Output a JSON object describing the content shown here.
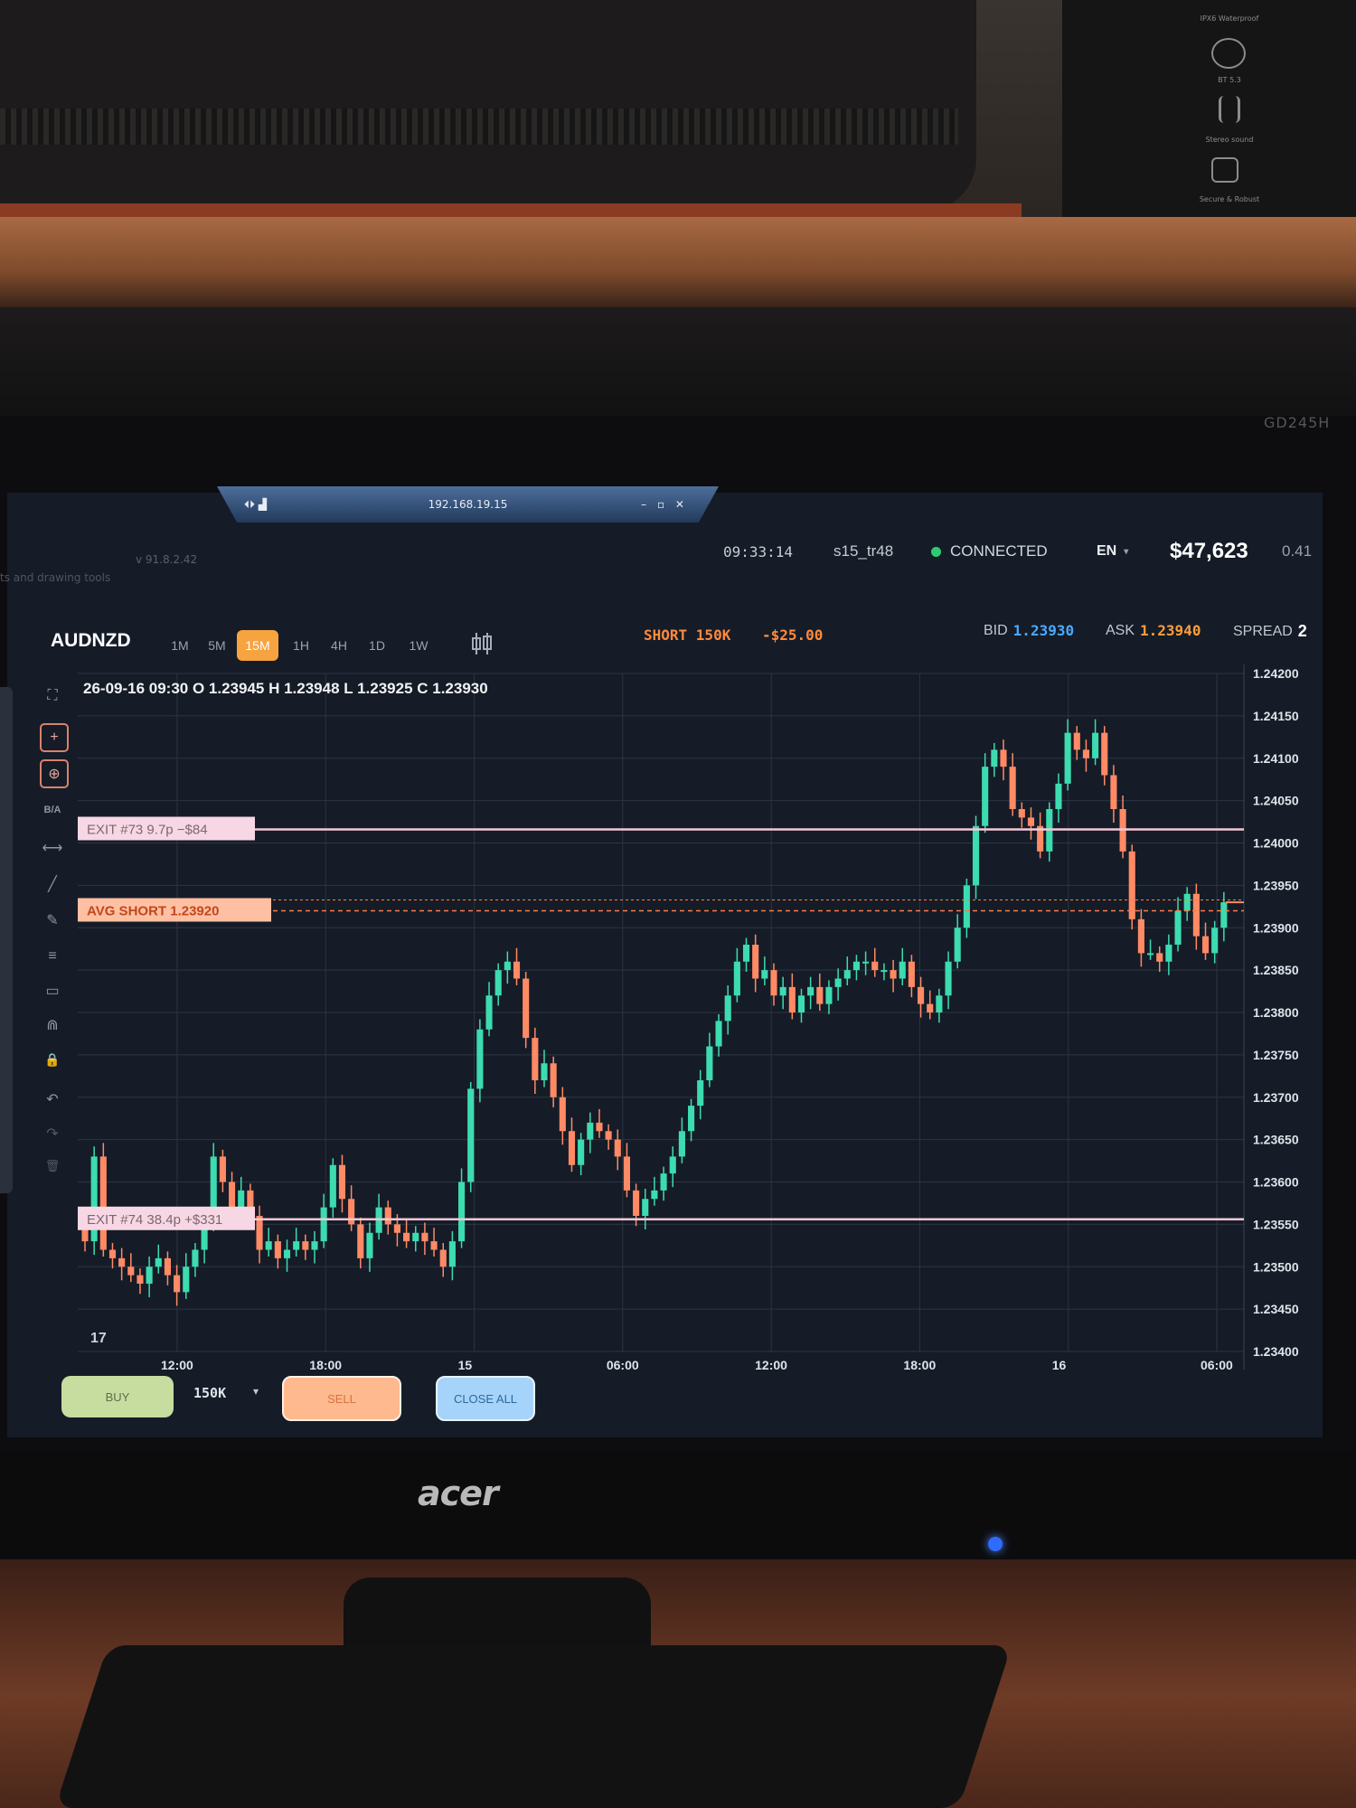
{
  "window": {
    "remote_host": "192.168.19.15",
    "remote_left_icons": "⏴⏵ ▟",
    "remote_controls": "– ▫ ✕",
    "version": "v 91.8.2.42",
    "tools_hint": "ts and drawing tools"
  },
  "status": {
    "clock": "09:33:14",
    "user": "s15_tr48",
    "connection": "CONNECTED",
    "language": "EN",
    "language_caret": "▾",
    "balance": "$47,623",
    "balance_extra": "0.41"
  },
  "toolbar": {
    "symbol": "AUDNZD",
    "timeframes": [
      "1M",
      "5M",
      "15M",
      "1H",
      "4H",
      "1D",
      "1W"
    ],
    "active_timeframe": "15M",
    "candle_icon": "candlestick-icon",
    "position": "SHORT 150K",
    "pnl": "-$25.00",
    "bid_label": "BID",
    "bid": "1.23930",
    "ask_label": "ASK",
    "ask": "1.23940",
    "spread_label": "SPREAD",
    "spread": "2"
  },
  "tools": {
    "fullscreen_icon": "⛶",
    "crosshair_icon": "+",
    "add_icon": "⊕",
    "ba_label": "B/A",
    "hline_icon": "⟷",
    "line_icon": "╱",
    "brush_icon": "✎",
    "fib_icon": "≡",
    "rect_icon": "▭",
    "magnet_icon": "⋒",
    "lock_icon": "🔒",
    "undo_icon": "↶",
    "redo_icon": "↷",
    "trash_icon": "🗑"
  },
  "ohlc": "26-09-16 09:30 O 1.23945 H 1.23948 L 1.23925 C 1.23930",
  "chart_data": {
    "type": "candlestick",
    "symbol": "AUDNZD",
    "timeframe": "15M",
    "y_ticks": [
      "1.24200",
      "1.24150",
      "1.24100",
      "1.24050",
      "1.24000",
      "1.23950",
      "1.23900",
      "1.23850",
      "1.23800",
      "1.23750",
      "1.23700",
      "1.23650",
      "1.23600",
      "1.23550",
      "1.23500",
      "1.23450",
      "1.23400"
    ],
    "ylim": [
      1.234,
      1.242
    ],
    "x_ticks": [
      "12:00",
      "18:00",
      "15",
      "06:00",
      "12:00",
      "18:00",
      "16",
      "06:00"
    ],
    "grid": true,
    "closes": [
      1.2353,
      1.2363,
      1.2352,
      1.2351,
      1.235,
      1.2349,
      1.2348,
      1.235,
      1.2351,
      1.2349,
      1.2347,
      1.235,
      1.2352,
      1.2355,
      1.2363,
      1.236,
      1.2357,
      1.2359,
      1.2356,
      1.2352,
      1.2353,
      1.2351,
      1.2352,
      1.2353,
      1.2352,
      1.2353,
      1.2357,
      1.2362,
      1.2358,
      1.2355,
      1.2351,
      1.2354,
      1.2357,
      1.2355,
      1.2354,
      1.2353,
      1.2354,
      1.2353,
      1.2352,
      1.235,
      1.2353,
      1.236,
      1.2371,
      1.2378,
      1.2382,
      1.2385,
      1.2386,
      1.2384,
      1.2377,
      1.2372,
      1.2374,
      1.237,
      1.2366,
      1.2362,
      1.2365,
      1.2367,
      1.2366,
      1.2365,
      1.2363,
      1.2359,
      1.2356,
      1.2358,
      1.2359,
      1.2361,
      1.2363,
      1.2366,
      1.2369,
      1.2372,
      1.2376,
      1.2379,
      1.2382,
      1.2386,
      1.2388,
      1.2384,
      1.2385,
      1.2382,
      1.2383,
      1.238,
      1.2382,
      1.2383,
      1.2381,
      1.2383,
      1.2384,
      1.2385,
      1.2386,
      1.2386,
      1.2385,
      1.2385,
      1.2384,
      1.2386,
      1.2383,
      1.2381,
      1.238,
      1.2382,
      1.2386,
      1.239,
      1.2395,
      1.2402,
      1.2409,
      1.2411,
      1.2409,
      1.2404,
      1.2403,
      1.2402,
      1.2399,
      1.2404,
      1.2407,
      1.2413,
      1.2411,
      1.241,
      1.2413,
      1.2408,
      1.2404,
      1.2399,
      1.2391,
      1.2387,
      1.2387,
      1.2386,
      1.2388,
      1.2392,
      1.2394,
      1.2389,
      1.2387,
      1.239,
      1.2393
    ],
    "annotations": [
      {
        "text": "EXIT #73  9.7p  −$84",
        "price": 1.24016,
        "style": "pink-line"
      },
      {
        "text": "AVG SHORT 1.23920",
        "price": 1.2392,
        "style": "orange-dashed"
      },
      {
        "text": "EXIT #74  38.4p  +$331",
        "price": 1.23556,
        "style": "pink-line"
      }
    ],
    "current_price": 1.2393
  },
  "order_panel": {
    "buy": "BUY",
    "quantity": "150K",
    "quantity_caret": "▾",
    "sell": "SELL",
    "close_all": "CLOSE ALL"
  },
  "hardware": {
    "brand": "acer",
    "model": "GD245H",
    "box_labels": [
      "IPX6 Waterproof",
      "BT 5.3",
      "Stereo sound",
      "Secure & Robust"
    ]
  },
  "colors": {
    "bull": "#3ddbb0",
    "bear": "#ff8a65",
    "grid": "#2b3443",
    "background": "#151c27",
    "pink_line": "#f4c6d6",
    "orange_line": "#ff7a45"
  }
}
